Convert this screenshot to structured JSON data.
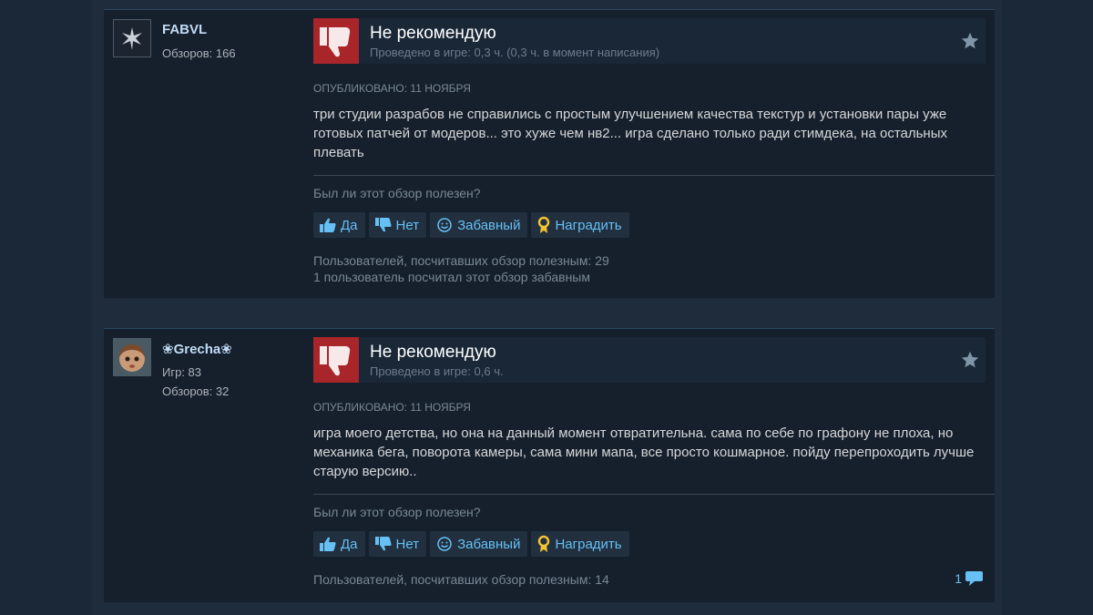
{
  "reviews": [
    {
      "author": "FABVL",
      "stats": [
        "Обзоров: 166"
      ],
      "verdict": "Не рекомендую",
      "hours": "Проведено в игре: 0,3 ч. (0,3 ч. в момент написания)",
      "posted": "Опубликовано: 11 ноября",
      "content": "три студии разрабов не справились с простым улучшением качества текстур и установки пары уже готовых патчей от модеров... это хуже чем нв2... игра сделано только ради стимдека, на остальных плевать",
      "helpful_question": "Был ли этот обзор полезен?",
      "buttons": {
        "yes": "Да",
        "no": "Нет",
        "funny": "Забавный",
        "award": "Наградить"
      },
      "helpful_count_text": "Пользователей, посчитавших обзор полезным: 29",
      "funny_count_text": "1 пользователь посчитал этот обзор забавным"
    },
    {
      "author": "❀Grecha❀",
      "stats": [
        "Игр: 83",
        "Обзоров: 32"
      ],
      "verdict": "Не рекомендую",
      "hours": "Проведено в игре: 0,6 ч.",
      "posted": "Опубликовано: 11 ноября",
      "content": "игра моего детства, но она на данный момент отвратительна. сама по себе по графону не плоха, но механика бега, поворота камеры, сама мини мапа, все просто кошмарное. пойду перепроходить лучше старую версию..",
      "helpful_question": "Был ли этот обзор полезен?",
      "buttons": {
        "yes": "Да",
        "no": "Нет",
        "funny": "Забавный",
        "award": "Наградить"
      },
      "helpful_count_text": "Пользователей, посчитавших обзор полезным: 14",
      "comments_count": "1"
    }
  ],
  "colors": {
    "background": "#1b2838",
    "card": "#16202d",
    "not_recommended": "#a8262a",
    "link": "#66c0f4"
  },
  "icons": {
    "thumbs_down": "thumbs-down-icon",
    "star": "star-icon",
    "thumb_up_small": "thumbs-up-icon",
    "smiley": "smiley-icon",
    "award": "award-icon",
    "comment": "comment-icon"
  }
}
